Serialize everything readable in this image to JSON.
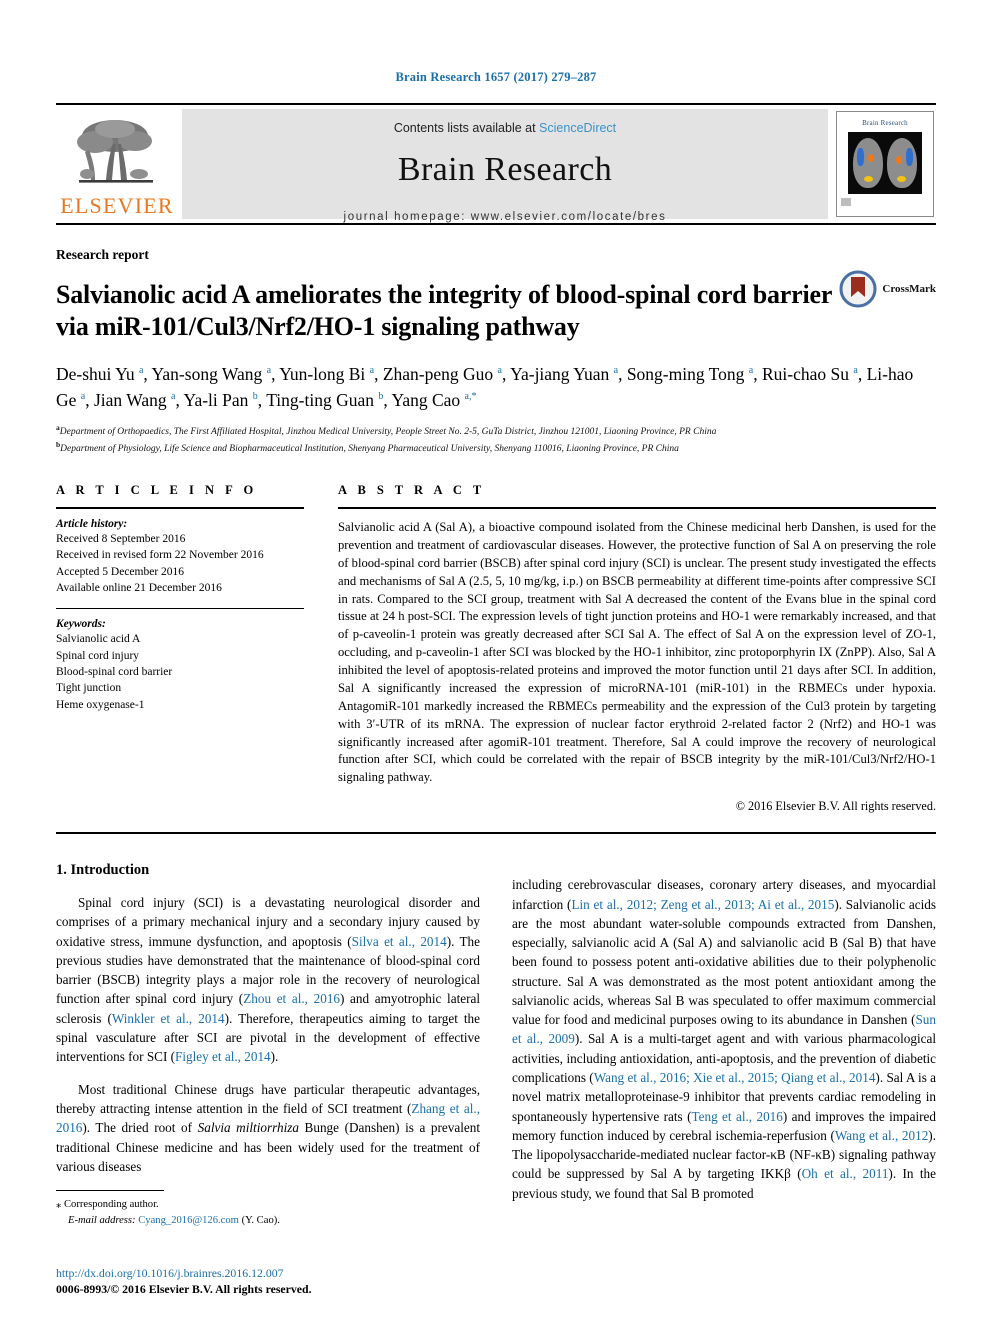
{
  "running_head": "Brain Research 1657 (2017) 279–287",
  "masthead": {
    "publisher": "ELSEVIER",
    "contents_prefix": "Contents lists available at ",
    "contents_link": "ScienceDirect",
    "journal_name": "Brain Research",
    "homepage": "journal homepage: www.elsevier.com/locate/bres",
    "cover_title": "Brain Research"
  },
  "article": {
    "kicker": "Research report",
    "title": "Salvianolic acid A ameliorates the integrity of blood-spinal cord barrier via miR-101/Cul3/Nrf2/HO-1 signaling pathway",
    "crossmark_label": "CrossMark",
    "authors_html": "De-shui Yu <sup>a</sup>, Yan-song Wang <sup>a</sup>, Yun-long Bi <sup>a</sup>, Zhan-peng Guo <sup>a</sup>, Ya-jiang Yuan <sup>a</sup>, Song-ming Tong <sup>a</sup>, Rui-chao Su <sup>a</sup>, Li-hao Ge <sup>a</sup>, Jian Wang <sup>a</sup>, Ya-li Pan <sup>b</sup>, Ting-ting Guan <sup>b</sup>, Yang Cao <sup>a,*</sup>",
    "affiliation_a": "Department of Orthopaedics, The First Affiliated Hospital, Jinzhou Medical University, People Street No. 2-5, GuTa District, Jinzhou 121001, Liaoning Province, PR China",
    "affiliation_b": "Department of Physiology, Life Science and Biopharmaceutical Institution, Shenyang Pharmaceutical University, Shenyang 110016, Liaoning Province, PR China",
    "affiliation_a_marker": "a",
    "affiliation_b_marker": "b"
  },
  "article_info": {
    "heading": "A R T I C L E    I N F O",
    "history_label": "Article history:",
    "history": [
      "Received 8 September 2016",
      "Received in revised form 22 November 2016",
      "Accepted 5 December 2016",
      "Available online 21 December 2016"
    ],
    "keywords_label": "Keywords:",
    "keywords": [
      "Salvianolic acid A",
      "Spinal cord injury",
      "Blood-spinal cord barrier",
      "Tight junction",
      "Heme oxygenase-1"
    ]
  },
  "abstract": {
    "heading": "A B S T R A C T",
    "text": "Salvianolic acid A (Sal A), a bioactive compound isolated from the Chinese medicinal herb Danshen, is used for the prevention and treatment of cardiovascular diseases. However, the protective function of Sal A on preserving the role of blood-spinal cord barrier (BSCB) after spinal cord injury (SCI) is unclear. The present study investigated the effects and mechanisms of Sal A (2.5, 5, 10 mg/kg, i.p.) on BSCB permeability at different time-points after compressive SCI in rats. Compared to the SCI group, treatment with Sal A decreased the content of the Evans blue in the spinal cord tissue at 24 h post-SCI. The expression levels of tight junction proteins and HO-1 were remarkably increased, and that of p-caveolin-1 protein was greatly decreased after SCI Sal A. The effect of Sal A on the expression level of ZO-1, occluding, and p-caveolin-1 after SCI was blocked by the HO-1 inhibitor, zinc protoporphyrin IX (ZnPP). Also, Sal A inhibited the level of apoptosis-related proteins and improved the motor function until 21 days after SCI. In addition, Sal A significantly increased the expression of microRNA-101 (miR-101) in the RBMECs under hypoxia. AntagomiR-101 markedly increased the RBMECs permeability and the expression of the Cul3 protein by targeting with 3′-UTR of its mRNA. The expression of nuclear factor erythroid 2-related factor 2 (Nrf2) and HO-1 was significantly increased after agomiR-101 treatment. Therefore, Sal A could improve the recovery of neurological function after SCI, which could be correlated with the repair of BSCB integrity by the miR-101/Cul3/Nrf2/HO-1 signaling pathway.",
    "copyright": "© 2016 Elsevier B.V. All rights reserved."
  },
  "introduction": {
    "heading": "1. Introduction",
    "left_paragraphs": [
      "Spinal cord injury (SCI) is a devastating neurological disorder and comprises of a primary mechanical injury and a secondary injury caused by oxidative stress, immune dysfunction, and apoptosis (|Silva et al., 2014|). The previous studies have demonstrated that the maintenance of blood-spinal cord barrier (BSCB) integrity plays a major role in the recovery of neurological function after spinal cord injury (|Zhou et al., 2016|) and amyotrophic lateral sclerosis (|Winkler et al., 2014|). Therefore, therapeutics aiming to target the spinal vasculature after SCI are pivotal in the development of effective interventions for SCI (|Figley et al., 2014|).",
      "Most traditional Chinese drugs have particular therapeutic advantages, thereby attracting intense attention in the field of SCI treatment (|Zhang et al., 2016|). The dried root of #Salvia miltiorrhiza# Bunge (Danshen) is a prevalent traditional Chinese medicine and has been widely used for the treatment of various diseases"
    ],
    "right_paragraphs": [
      "including cerebrovascular diseases, coronary artery diseases, and myocardial infarction (|Lin et al., 2012; Zeng et al., 2013; Ai et al., 2015|). Salvianolic acids are the most abundant water-soluble compounds extracted from Danshen, especially, salvianolic acid A (Sal A) and salvianolic acid B (Sal B) that have been found to possess potent anti-oxidative abilities due to their polyphenolic structure. Sal A was demonstrated as the most potent antioxidant among the salvianolic acids, whereas Sal B was speculated to offer maximum commercial value for food and medicinal purposes owing to its abundance in Danshen (|Sun et al., 2009|). Sal A is a multi-target agent and with various pharmacological activities, including antioxidation, anti-apoptosis, and the prevention of diabetic complications (|Wang et al., 2016; Xie et al., 2015; Qiang et al., 2014|). Sal A is a novel matrix metalloproteinase-9 inhibitor that prevents cardiac remodeling in spontaneously hypertensive rats (|Teng et al., 2016|) and improves the impaired memory function induced by cerebral ischemia-reperfusion (|Wang et al., 2012|). The lipopolysaccharide-mediated nuclear factor-κB (NF-κB) signaling pathway could be suppressed by Sal A by targeting IKKβ (|Oh et al., 2011|). In the previous study, we found that Sal B promoted"
    ]
  },
  "footnote": {
    "marker": "⁎",
    "corresponding": "Corresponding author.",
    "email_label": "E-mail address:",
    "email": "Cyang_2016@126.com",
    "email_suffix": "(Y. Cao)."
  },
  "page_footer": {
    "doi": "http://dx.doi.org/10.1016/j.brainres.2016.12.007",
    "issn": "0006-8993/© 2016 Elsevier B.V. All rights reserved."
  },
  "colors": {
    "link_blue": "#1a6fa8",
    "sciencedirect_blue": "#3a93c8",
    "elsevier_orange": "#E87722"
  }
}
